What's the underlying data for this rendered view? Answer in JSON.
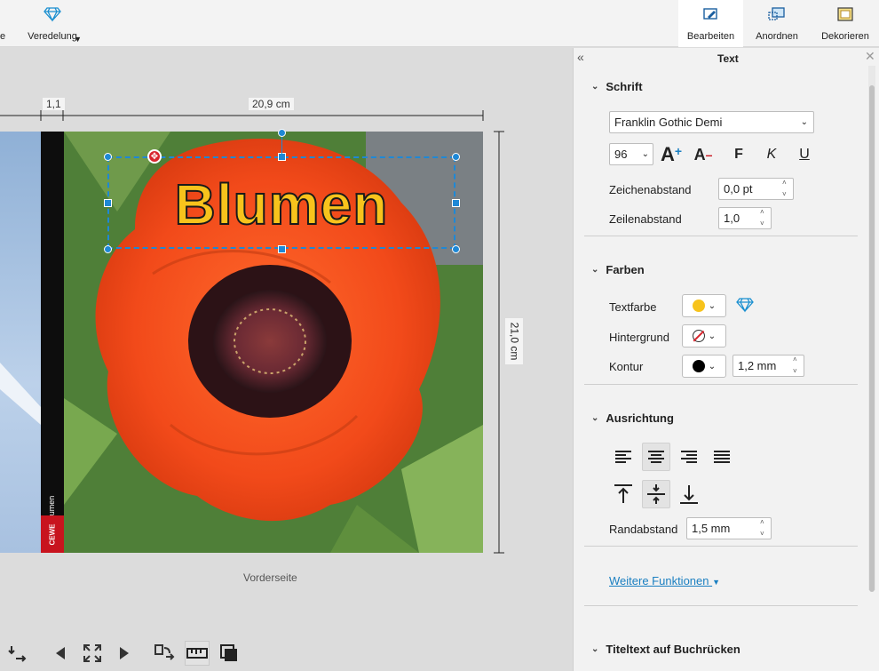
{
  "toolbar": {
    "partial_label": "e",
    "veredelung_label": "Veredelung",
    "bearbeiten_label": "Bearbeiten",
    "anordnen_label": "Anordnen",
    "dekorieren_label": "Dekorieren"
  },
  "canvas": {
    "spine_width": "1,1",
    "page_width": "20,9 cm",
    "page_height": "21,0 cm",
    "title_text": "Blumen",
    "spine_text": "Blumen",
    "brand_text": "CEWE",
    "page_label": "Vorderseite"
  },
  "panel": {
    "title": "Text",
    "collapse_label": "«",
    "schrift": {
      "header": "Schrift",
      "font_value": "Franklin Gothic Demi",
      "size_value": "96",
      "grow_label": "A",
      "shrink_label": "A",
      "bold_label": "F",
      "italic_label": "K",
      "underline_label": "U",
      "letter_spacing_label": "Zeichenabstand",
      "letter_spacing_value": "0,0 pt",
      "line_spacing_label": "Zeilenabstand",
      "line_spacing_value": "1,0"
    },
    "farben": {
      "header": "Farben",
      "text_color_label": "Textfarbe",
      "text_color": "#f7c31c",
      "background_label": "Hintergrund",
      "outline_label": "Kontur",
      "outline_color": "#000000",
      "outline_value": "1,2 mm"
    },
    "ausrichtung": {
      "header": "Ausrichtung",
      "padding_label": "Randabstand",
      "padding_value": "1,5 mm"
    },
    "more_link": "Weitere Funktionen",
    "spine_section": "Titeltext auf Buchrücken"
  },
  "colors": {
    "accent": "#1e88d6",
    "link": "#1a7fc1"
  }
}
